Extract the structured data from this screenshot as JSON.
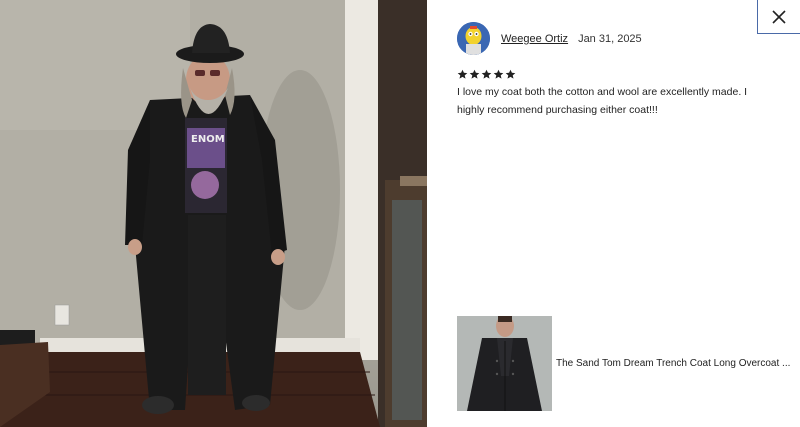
{
  "review": {
    "reviewer_name": "Weegee Ortiz",
    "date": "Jan 31, 2025",
    "rating": 5,
    "text": "I love my coat both the cotton and wool are excellently made. I highly recommend purchasing either coat!!!"
  },
  "product": {
    "title": "The Sand Tom Dream Trench Coat Long Overcoat ..."
  },
  "icons": {
    "close": "close-icon",
    "star": "star-icon"
  },
  "colors": {
    "close_border": "#4a6aa8",
    "star": "#222222",
    "text": "#222222"
  }
}
